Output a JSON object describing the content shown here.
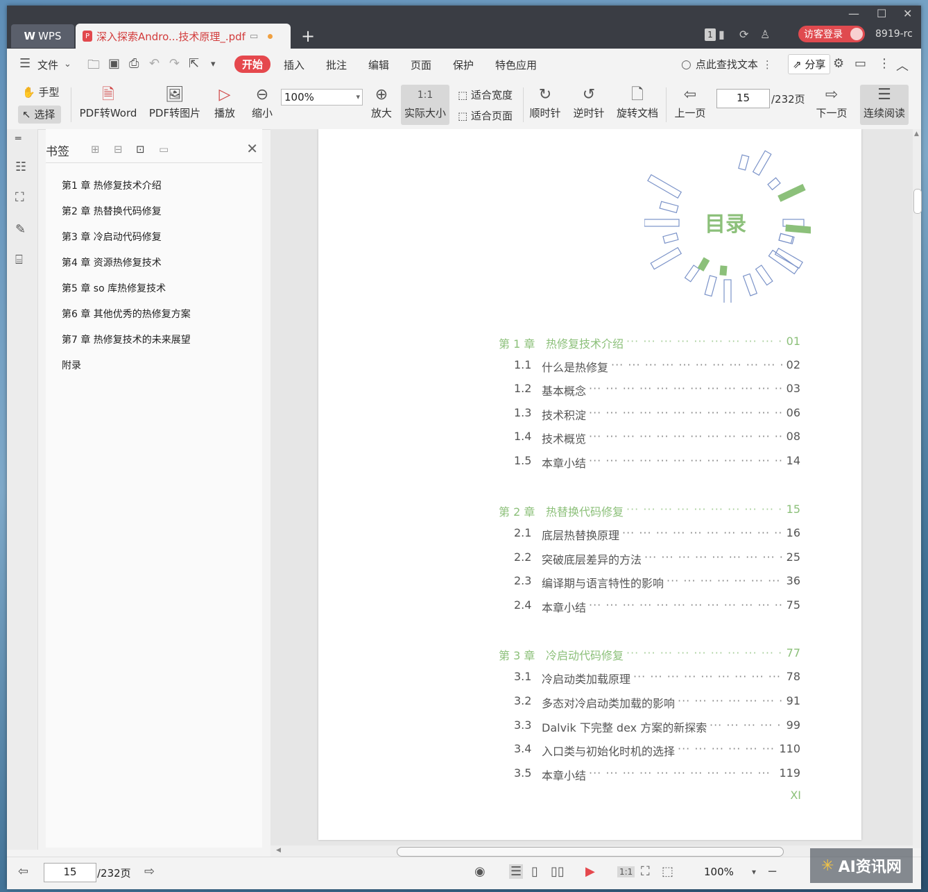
{
  "titlebar": {
    "app_tab": "WPS",
    "doc_tab": "深入探索Andro...技术原理_.pdf",
    "badge": "1",
    "login": "访客登录",
    "user_id": "8919-rc"
  },
  "menu": {
    "file": "文件",
    "items": [
      "开始",
      "插入",
      "批注",
      "编辑",
      "页面",
      "保护",
      "特色应用"
    ],
    "search": "点此查找文本",
    "share": "分享"
  },
  "toolbar": {
    "hand": "手型",
    "select": "选择",
    "pdf_to_word": "PDF转Word",
    "pdf_to_image": "PDF转图片",
    "play": "播放",
    "zoom_out": "缩小",
    "zoom_value": "100%",
    "zoom_in": "放大",
    "actual_size": "实际大小",
    "fit_width": "适合宽度",
    "fit_page": "适合页面",
    "clockwise": "顺时针",
    "counter_clockwise": "逆时针",
    "rotate_doc": "旋转文档",
    "prev_page": "上一页",
    "page_value": "15",
    "page_total": "/232页",
    "next_page": "下一页",
    "continuous": "连续阅读"
  },
  "bookmarks": {
    "title": "书签",
    "items": [
      "第1 章 热修复技术介绍",
      "第2 章 热替换代码修复",
      "第3 章 冷启动代码修复",
      "第4 章 资源热修复技术",
      "第5 章 so 库热修复技术",
      "第6 章 其他优秀的热修复方案",
      "第7 章 热修复技术的未来展望",
      "附录"
    ]
  },
  "document": {
    "toc_title": "目录",
    "page_footer": "XI",
    "toc": [
      {
        "kind": "chap",
        "num": "第 1 章",
        "title": "热修复技术介绍",
        "page": "01"
      },
      {
        "kind": "sec",
        "num": "1.1",
        "title": "什么是热修复",
        "page": "02"
      },
      {
        "kind": "sec",
        "num": "1.2",
        "title": "基本概念",
        "page": "03"
      },
      {
        "kind": "sec",
        "num": "1.3",
        "title": "技术积淀",
        "page": "06"
      },
      {
        "kind": "sec",
        "num": "1.4",
        "title": "技术概览",
        "page": "08"
      },
      {
        "kind": "sec",
        "num": "1.5",
        "title": "本章小结",
        "page": "14"
      },
      {
        "kind": "chap",
        "num": "第 2 章",
        "title": "热替换代码修复",
        "page": "15"
      },
      {
        "kind": "sec",
        "num": "2.1",
        "title": "底层热替换原理",
        "page": "16"
      },
      {
        "kind": "sec",
        "num": "2.2",
        "title": "突破底层差异的方法",
        "page": "25"
      },
      {
        "kind": "sec",
        "num": "2.3",
        "title": "编译期与语言特性的影响",
        "page": "36"
      },
      {
        "kind": "sec",
        "num": "2.4",
        "title": "本章小结",
        "page": "75"
      },
      {
        "kind": "chap",
        "num": "第 3 章",
        "title": "冷启动代码修复",
        "page": "77"
      },
      {
        "kind": "sec",
        "num": "3.1",
        "title": "冷启动类加载原理",
        "page": "78"
      },
      {
        "kind": "sec",
        "num": "3.2",
        "title": "多态对冷启动类加载的影响",
        "page": "91"
      },
      {
        "kind": "sec",
        "num": "3.3",
        "title": "Dalvik 下完整 dex 方案的新探索",
        "page": "99"
      },
      {
        "kind": "sec",
        "num": "3.4",
        "title": "入口类与初始化时机的选择",
        "page": "110"
      },
      {
        "kind": "sec",
        "num": "3.5",
        "title": "本章小结",
        "page": "119"
      }
    ]
  },
  "status": {
    "page_value": "15",
    "page_total": "/232页",
    "zoom": "100%"
  },
  "watermark": "AI资讯网",
  "colors": {
    "accent": "#e5484d",
    "toc_green": "#8cc07a"
  }
}
